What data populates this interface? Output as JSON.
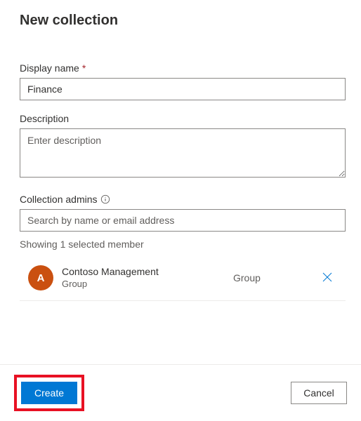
{
  "page": {
    "title": "New collection"
  },
  "form": {
    "display_name": {
      "label": "Display name",
      "value": "Finance",
      "required_marker": "*"
    },
    "description": {
      "label": "Description",
      "placeholder": "Enter description",
      "value": ""
    },
    "admins": {
      "label": "Collection admins",
      "search_placeholder": "Search by name or email address",
      "status": "Showing 1 selected member",
      "members": [
        {
          "initial": "A",
          "name": "Contoso Management",
          "subtitle": "Group",
          "type": "Group"
        }
      ]
    }
  },
  "footer": {
    "create": "Create",
    "cancel": "Cancel"
  }
}
